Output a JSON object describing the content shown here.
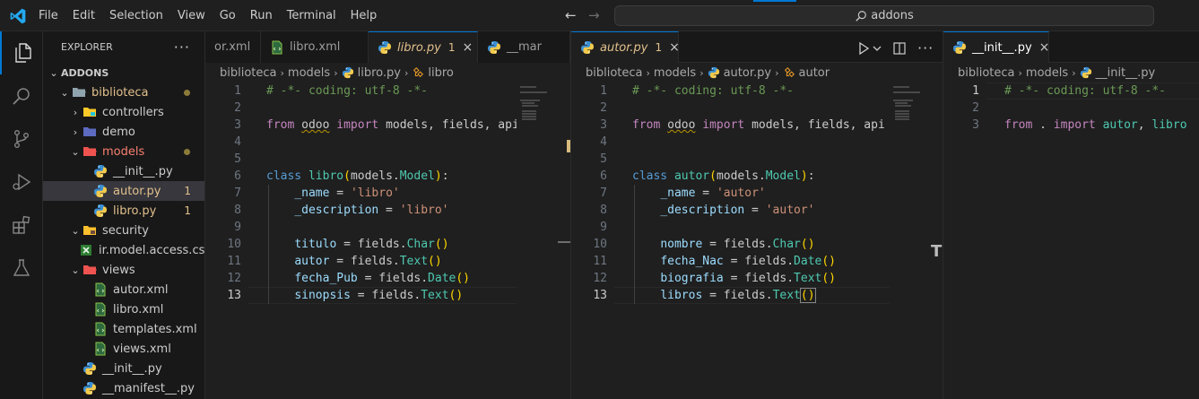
{
  "menu": [
    "File",
    "Edit",
    "Selection",
    "View",
    "Go",
    "Run",
    "Terminal",
    "Help"
  ],
  "search": {
    "text": "addons"
  },
  "explorer": {
    "title": "EXPLORER",
    "more": "···",
    "root": "ADDONS",
    "items": [
      {
        "label": "biblioteca",
        "depth": 1,
        "type": "folder-open",
        "state": "mod",
        "dot": true
      },
      {
        "label": "controllers",
        "depth": 2,
        "type": "folder-closed",
        "state": ""
      },
      {
        "label": "demo",
        "depth": 2,
        "type": "folder-closed",
        "state": ""
      },
      {
        "label": "models",
        "depth": 2,
        "type": "folder-open",
        "state": "err",
        "dot": true
      },
      {
        "label": "__init__.py",
        "depth": 3,
        "type": "py",
        "state": ""
      },
      {
        "label": "autor.py",
        "depth": 3,
        "type": "py",
        "state": "mod",
        "badge": "1",
        "selected": true
      },
      {
        "label": "libro.py",
        "depth": 3,
        "type": "py",
        "state": "mod",
        "badge": "1"
      },
      {
        "label": "security",
        "depth": 2,
        "type": "folder-open",
        "state": ""
      },
      {
        "label": "ir.model.access.csv",
        "depth": 3,
        "type": "csv",
        "state": ""
      },
      {
        "label": "views",
        "depth": 2,
        "type": "folder-open",
        "state": ""
      },
      {
        "label": "autor.xml",
        "depth": 3,
        "type": "xml",
        "state": ""
      },
      {
        "label": "libro.xml",
        "depth": 3,
        "type": "xml",
        "state": ""
      },
      {
        "label": "templates.xml",
        "depth": 3,
        "type": "xml",
        "state": ""
      },
      {
        "label": "views.xml",
        "depth": 3,
        "type": "xml",
        "state": ""
      },
      {
        "label": "__init__.py",
        "depth": 2,
        "type": "py",
        "state": ""
      },
      {
        "label": "__manifest__.py",
        "depth": 2,
        "type": "py",
        "state": ""
      }
    ]
  },
  "group1": {
    "tabs": [
      {
        "label": "or.xml",
        "type": "xml"
      },
      {
        "label": "libro.xml",
        "type": "xml"
      },
      {
        "label": "libro.py",
        "type": "py",
        "active": true,
        "count": "1",
        "close": "×"
      },
      {
        "label": "__mar",
        "type": "py"
      }
    ],
    "breadcrumb": [
      "biblioteca",
      "models",
      "libro.py",
      "libro"
    ],
    "lines": [
      "1",
      "2",
      "3",
      "4",
      "5",
      "6",
      "7",
      "8",
      "9",
      "10",
      "11",
      "12",
      "13"
    ]
  },
  "group2": {
    "tabs": [
      {
        "label": "autor.py",
        "type": "py",
        "active": true,
        "count": "1",
        "close": "×"
      }
    ],
    "breadcrumb": [
      "biblioteca",
      "models",
      "autor.py",
      "autor"
    ],
    "lines": [
      "1",
      "2",
      "3",
      "4",
      "5",
      "6",
      "7",
      "8",
      "9",
      "10",
      "11",
      "12",
      "13"
    ]
  },
  "group3": {
    "tabs": [
      {
        "label": "__init__.py",
        "type": "py",
        "active": true,
        "close": "×"
      }
    ],
    "breadcrumb": [
      "biblioteca",
      "models",
      "__init__.py"
    ],
    "lines": [
      "1",
      "2",
      "3"
    ]
  },
  "icons": {
    "explorer": "files-icon",
    "search": "search-icon",
    "scm": "source-control-icon",
    "debug": "run-debug-icon",
    "extensions": "extensions-icon",
    "testing": "flask-icon"
  },
  "colors": {
    "accent": "#0078d4",
    "modified": "#e2c08d",
    "error": "#f88070"
  }
}
